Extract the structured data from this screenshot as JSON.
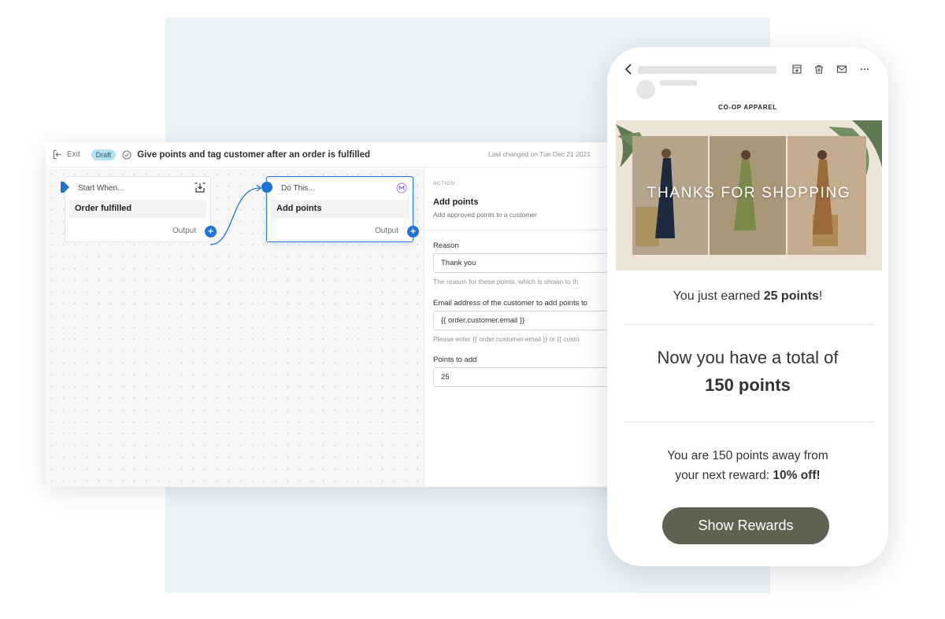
{
  "editor": {
    "exit_label": "Exit",
    "status_badge": "Draft",
    "flow_title": "Give points and tag customer after an order is fulfilled",
    "last_changed": "Last changed on Tue Dec 21 2021",
    "trigger_node": {
      "header": "Start When...",
      "value": "Order fulfilled",
      "output_label": "Output"
    },
    "action_node": {
      "header": "Do This...",
      "value": "Add points",
      "output_label": "Output"
    },
    "panel": {
      "section_label": "ACTION",
      "title": "Add points",
      "description": "Add approved points to a customer",
      "fields": {
        "reason": {
          "label": "Reason",
          "value": "Thank you",
          "help": "The reason for these points, which is shown to th"
        },
        "email": {
          "label": "Email address of the customer to add points to",
          "value": "{{ order.customer.email }}",
          "help": "Please enter {{ order.customer.email }} or {{ custo"
        },
        "points": {
          "label": "Points to add",
          "value": "25"
        }
      }
    }
  },
  "phone": {
    "brand": "CO-OP APPAREL",
    "hero_text": "THANKS FOR SHOPPING",
    "earned": {
      "prefix": "You just earned ",
      "bold": "25 points",
      "suffix": "!"
    },
    "total": {
      "line1": "Now you have a total of",
      "line2": "150 points"
    },
    "away": {
      "line1": "You are 150 points away from",
      "line2_prefix": "your next reward: ",
      "line2_bold": "10% off!"
    },
    "button_label": "Show Rewards"
  },
  "colors": {
    "accent_blue": "#1f73d8",
    "badge_bg": "#b3e0ef",
    "background_panel": "#eaf4f9",
    "button_olive": "#5d6350"
  },
  "icons": [
    "exit-icon",
    "check-circle-icon",
    "download-icon",
    "app-badge-icon",
    "plus-icon",
    "back-chevron-icon",
    "archive-icon",
    "trash-icon",
    "mail-icon",
    "more-icon"
  ]
}
